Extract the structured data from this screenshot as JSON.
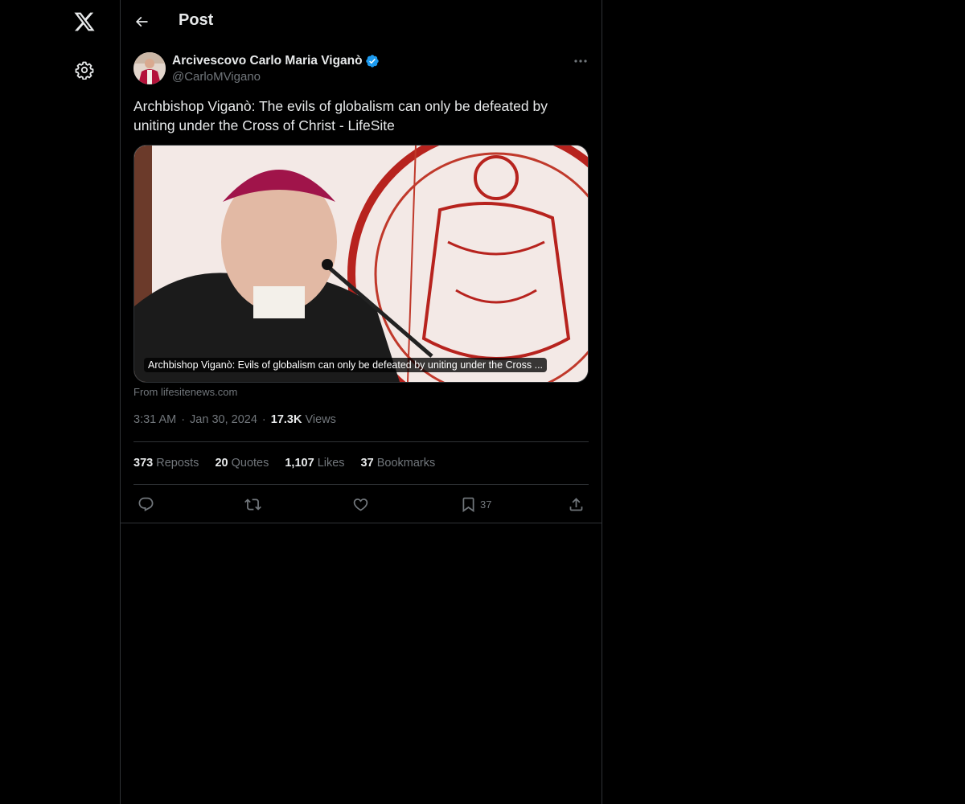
{
  "header": {
    "title": "Post"
  },
  "sidebar": {
    "logo_icon": "x-logo-icon",
    "settings_icon": "gear-icon"
  },
  "post": {
    "author": {
      "display_name": "Arcivescovo Carlo Maria Viganò",
      "handle": "@CarloMVigano",
      "verified": true
    },
    "text_line1": "Archbishop Viganò: The evils of globalism can only be defeated by",
    "text_line2": "uniting under the Cross of Christ - LifeSite",
    "card": {
      "caption": "Archbishop Viganò: Evils of globalism can only be defeated by uniting under the Cross ...",
      "source": "From lifesitenews.com"
    },
    "time": "3:31 AM",
    "date": "Jan 30, 2024",
    "views_count": "17.3K",
    "views_label": "Views",
    "stats": {
      "reposts_count": "373",
      "reposts_label": "Reposts",
      "quotes_count": "20",
      "quotes_label": "Quotes",
      "likes_count": "1,107",
      "likes_label": "Likes",
      "bookmarks_count": "37",
      "bookmarks_label": "Bookmarks"
    },
    "actions": {
      "bookmark_count": "37"
    }
  },
  "colors": {
    "background": "#000000",
    "text": "#e7e9ea",
    "muted": "#71767b",
    "border": "#2f3336",
    "verified": "#1d9bf0"
  }
}
